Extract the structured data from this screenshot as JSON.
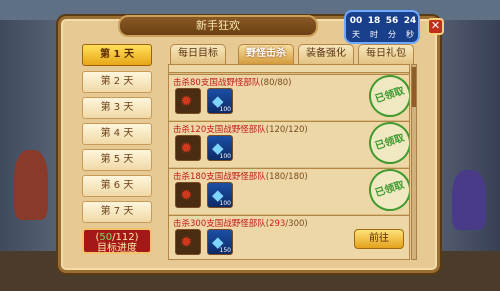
{
  "window": {
    "title": "新手狂欢"
  },
  "timer": {
    "days": "00",
    "days_unit": "天",
    "hours": "18",
    "hours_unit": "时",
    "minutes": "56",
    "minutes_unit": "分",
    "seconds": "24",
    "seconds_unit": "秒"
  },
  "close_label": "✕",
  "days": [
    {
      "label": "第 1 天",
      "active": true
    },
    {
      "label": "第 2 天",
      "active": false
    },
    {
      "label": "第 3 天",
      "active": false
    },
    {
      "label": "第 4 天",
      "active": false
    },
    {
      "label": "第 5 天",
      "active": false
    },
    {
      "label": "第 6 天",
      "active": false
    },
    {
      "label": "第 7 天",
      "active": false
    }
  ],
  "progress": {
    "current": "50",
    "total": "/112)",
    "open": "(",
    "label": "目标进度"
  },
  "tabs": [
    {
      "label": "每日目标",
      "active": false
    },
    {
      "label": "野怪击杀",
      "active": true
    },
    {
      "label": "装备强化",
      "active": false
    },
    {
      "label": "每日礼包",
      "active": false
    }
  ],
  "tasks": [
    {
      "title": "击杀80支国战野怪部队",
      "progress_open": "(",
      "progress_cur": "80",
      "progress_rest": "/80)",
      "gem_qty": "100",
      "status": "已领取"
    },
    {
      "title": "击杀120支国战野怪部队",
      "progress_open": "(",
      "progress_cur": "120",
      "progress_rest": "/120)",
      "gem_qty": "100",
      "status": "已领取"
    },
    {
      "title": "击杀180支国战野怪部队",
      "progress_open": "(",
      "progress_cur": "180",
      "progress_rest": "/180)",
      "gem_qty": "100",
      "status": "已领取"
    },
    {
      "title": "击杀300支国战野怪部队",
      "progress_open": "(",
      "progress_cur": "293",
      "progress_rest": "/300)",
      "gem_qty": "150",
      "action": "前往"
    }
  ],
  "icons": {
    "item": "red-gear-item-icon",
    "gem": "blue-diamond-icon"
  }
}
